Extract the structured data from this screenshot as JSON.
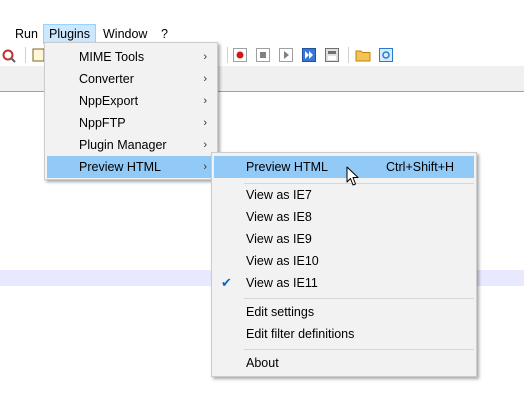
{
  "menubar": {
    "items": [
      {
        "label": "Run"
      },
      {
        "label": "Plugins"
      },
      {
        "label": "Window"
      },
      {
        "label": "?"
      }
    ]
  },
  "plugins_menu": {
    "items": [
      {
        "label": "MIME Tools",
        "arrow": "›"
      },
      {
        "label": "Converter",
        "arrow": "›"
      },
      {
        "label": "NppExport",
        "arrow": "›"
      },
      {
        "label": "NppFTP",
        "arrow": "›"
      },
      {
        "label": "Plugin Manager",
        "arrow": "›"
      },
      {
        "label": "Preview HTML",
        "arrow": "›"
      }
    ]
  },
  "preview_menu": {
    "preview": {
      "label": "Preview HTML",
      "shortcut": "Ctrl+Shift+H"
    },
    "views": [
      {
        "label": "View as IE7"
      },
      {
        "label": "View as IE8"
      },
      {
        "label": "View as IE9"
      },
      {
        "label": "View as IE10"
      },
      {
        "label": "View as IE11",
        "check": "✔"
      }
    ],
    "edit_settings": {
      "label": "Edit settings"
    },
    "edit_filters": {
      "label": "Edit filter definitions"
    },
    "about": {
      "label": "About"
    }
  },
  "colors": {
    "highlight": "#91c9f7",
    "menubar_active": "#cce8ff",
    "current_line": "#e8e8ff"
  }
}
